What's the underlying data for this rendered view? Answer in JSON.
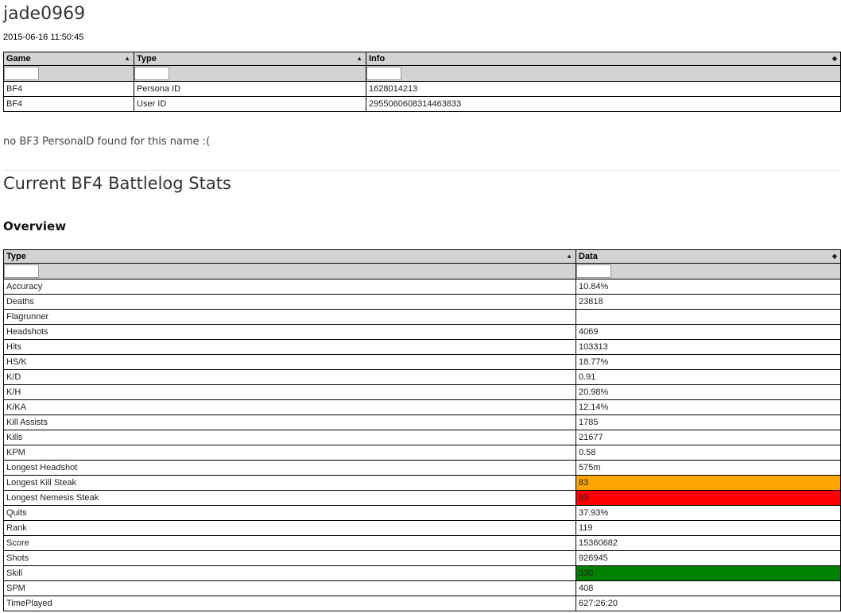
{
  "player": {
    "name": "jade0969",
    "timestamp": "2015-06-16 11:50:45"
  },
  "ids_table": {
    "columns": [
      {
        "label": "Game",
        "sort": "▲"
      },
      {
        "label": "Type",
        "sort": "▲"
      },
      {
        "label": "Info",
        "sort": "◆"
      }
    ],
    "rows": [
      [
        "BF4",
        "Persona ID",
        "1628014213"
      ],
      [
        "BF4",
        "User ID",
        "2955060608314463833"
      ]
    ]
  },
  "notice": "no BF3 PersonalD found for this name :(",
  "section_title": "Current BF4 Battlelog Stats",
  "overview": {
    "title": "Overview",
    "columns": [
      {
        "label": "Type",
        "sort": "▲"
      },
      {
        "label": "Data",
        "sort": "◆"
      }
    ],
    "rows": [
      {
        "type": "Accuracy",
        "data": "10.84%",
        "highlight": ""
      },
      {
        "type": "Deaths",
        "data": "23818",
        "highlight": ""
      },
      {
        "type": "Flagrunner",
        "data": "",
        "highlight": ""
      },
      {
        "type": "Headshots",
        "data": "4069",
        "highlight": ""
      },
      {
        "type": "Hits",
        "data": "103313",
        "highlight": ""
      },
      {
        "type": "HS/K",
        "data": "18.77%",
        "highlight": ""
      },
      {
        "type": "K/D",
        "data": "0.91",
        "highlight": ""
      },
      {
        "type": "K/H",
        "data": "20.98%",
        "highlight": ""
      },
      {
        "type": "K/KA",
        "data": "12.14%",
        "highlight": ""
      },
      {
        "type": "Kill Assists",
        "data": "1785",
        "highlight": ""
      },
      {
        "type": "Kills",
        "data": "21677",
        "highlight": ""
      },
      {
        "type": "KPM",
        "data": "0.58",
        "highlight": ""
      },
      {
        "type": "Longest Headshot",
        "data": "575m",
        "highlight": ""
      },
      {
        "type": "Longest Kill Steak",
        "data": "83",
        "highlight": "#ffa500"
      },
      {
        "type": "Longest Nemesis Steak",
        "data": "83",
        "highlight": "#ff0000"
      },
      {
        "type": "Quits",
        "data": "37.93%",
        "highlight": ""
      },
      {
        "type": "Rank",
        "data": "119",
        "highlight": ""
      },
      {
        "type": "Score",
        "data": "15360682",
        "highlight": ""
      },
      {
        "type": "Shots",
        "data": "926945",
        "highlight": ""
      },
      {
        "type": "Skill",
        "data": "330",
        "highlight": "#008000"
      },
      {
        "type": "SPM",
        "data": "408",
        "highlight": ""
      },
      {
        "type": "TimePlayed",
        "data": "627:26:20",
        "highlight": ""
      }
    ]
  }
}
